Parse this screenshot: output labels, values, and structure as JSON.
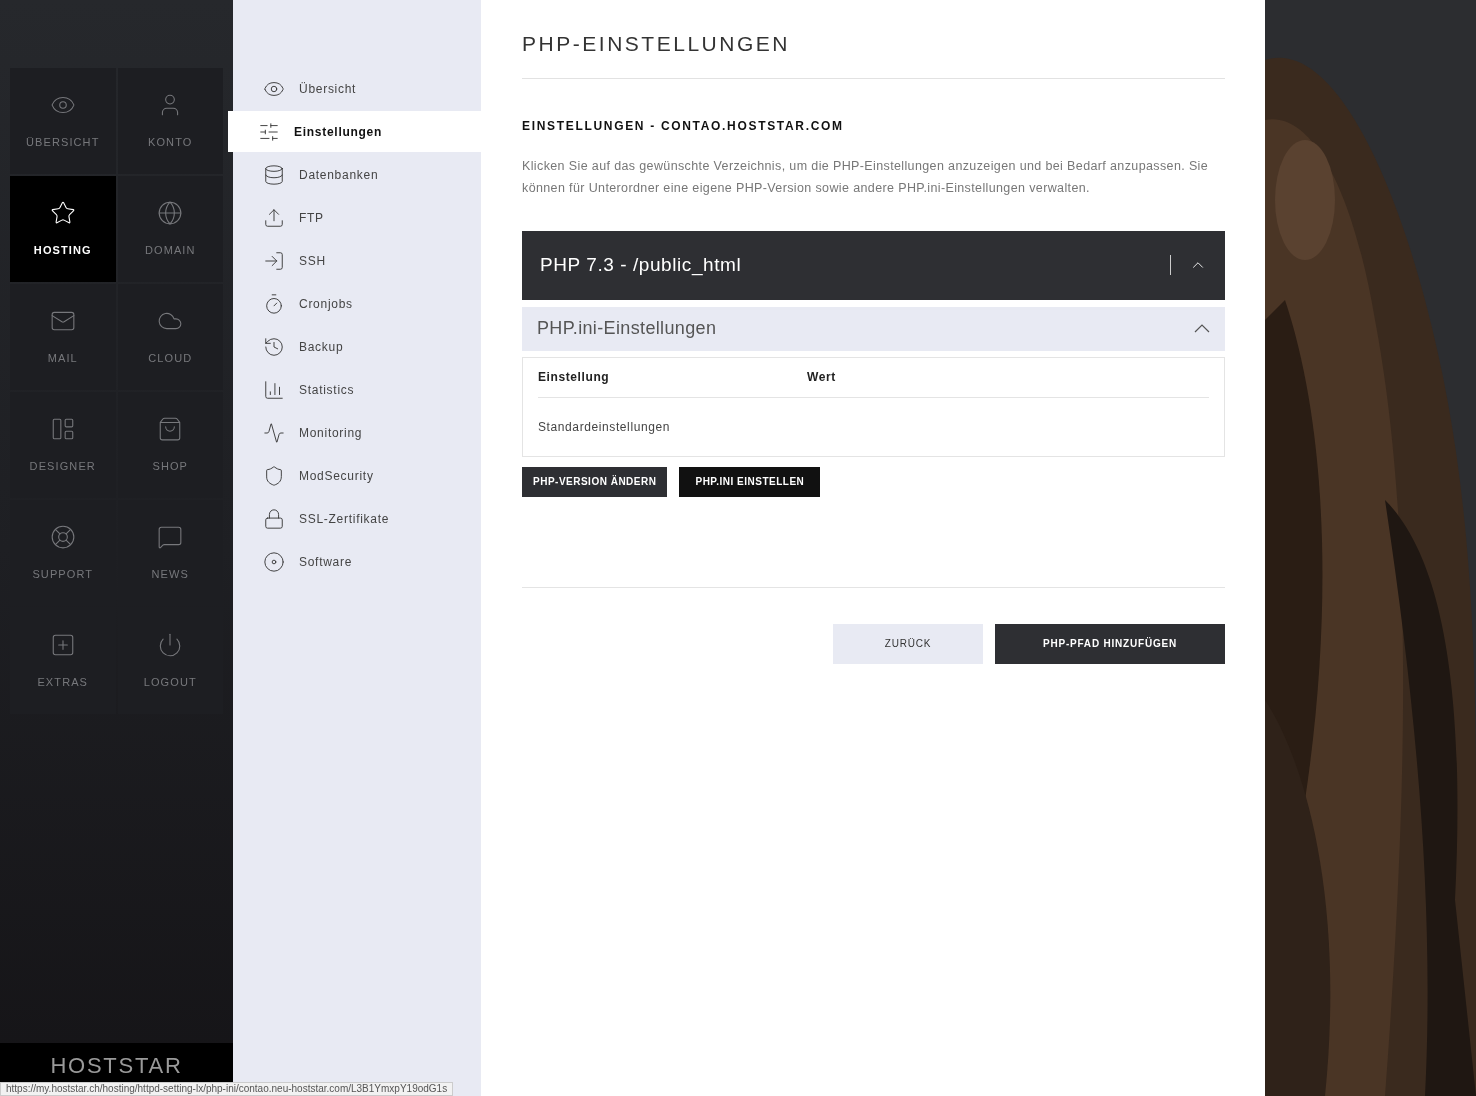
{
  "main_menu": [
    {
      "label": "ÜBERSICHT",
      "selected": false
    },
    {
      "label": "KONTO",
      "selected": false
    },
    {
      "label": "HOSTING",
      "selected": true
    },
    {
      "label": "DOMAIN",
      "selected": false
    },
    {
      "label": "MAIL",
      "selected": false
    },
    {
      "label": "CLOUD",
      "selected": false
    },
    {
      "label": "DESIGNER",
      "selected": false
    },
    {
      "label": "SHOP",
      "selected": false
    },
    {
      "label": "SUPPORT",
      "selected": false
    },
    {
      "label": "NEWS",
      "selected": false
    },
    {
      "label": "EXTRAS",
      "selected": false
    },
    {
      "label": "LOGOUT",
      "selected": false
    }
  ],
  "logo": "HOSTSTAR",
  "sub_menu": [
    {
      "label": "Übersicht",
      "selected": false
    },
    {
      "label": "Einstellungen",
      "selected": true
    },
    {
      "label": "Datenbanken",
      "selected": false
    },
    {
      "label": "FTP",
      "selected": false
    },
    {
      "label": "SSH",
      "selected": false
    },
    {
      "label": "Cronjobs",
      "selected": false
    },
    {
      "label": "Backup",
      "selected": false
    },
    {
      "label": "Statistics",
      "selected": false
    },
    {
      "label": "Monitoring",
      "selected": false
    },
    {
      "label": "ModSecurity",
      "selected": false
    },
    {
      "label": "SSL-Zertifikate",
      "selected": false
    },
    {
      "label": "Software",
      "selected": false
    }
  ],
  "page_title": "PHP-EINSTELLUNGEN",
  "section_title": "EINSTELLUNGEN - CONTAO.HOSTSTAR.COM",
  "description": "Klicken Sie auf das gewünschte Verzeichnis, um die PHP-Einstellungen anzuzeigen und bei Bedarf anzupassen. Sie können für Unterordner eine eigene PHP-Version sowie andere PHP.ini-Einstellungen verwalten.",
  "php_path": {
    "title": "PHP 7.3 - /public_html",
    "expanded": true,
    "ini_section": {
      "title": "PHP.ini-Einstellungen",
      "expanded": true,
      "table": {
        "columns": [
          "Einstellung",
          "Wert"
        ],
        "rows": [
          [
            "Standardeinstellungen"
          ]
        ]
      }
    },
    "buttons": [
      "PHP-VERSION ÄNDERN",
      "PHP.INI EINSTELLEN"
    ]
  },
  "footer_buttons": [
    {
      "label": "ZURÜCK",
      "kind": "secondary"
    },
    {
      "label": "PHP-PFAD HINZUFÜGEN",
      "kind": "primary"
    }
  ],
  "status_bar": "https://my.hoststar.ch/hosting/httpd-setting-lx/php-ini/contao.neu-hoststar.com/L3B1YmxpY19odG1s"
}
